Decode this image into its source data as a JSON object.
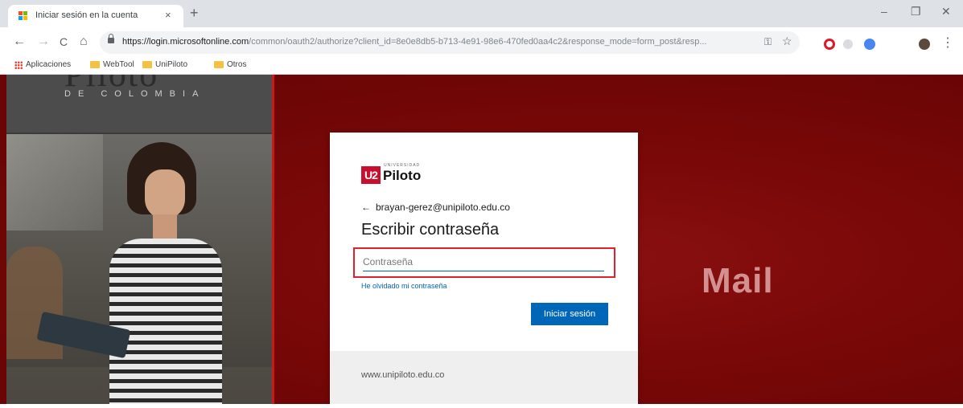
{
  "browser": {
    "tab": {
      "title": "Iniciar sesión en la cuenta",
      "close": "×"
    },
    "new_tab": "+",
    "window_controls": {
      "minimize": "–",
      "restore": "❐",
      "close": "✕"
    },
    "nav": {
      "back": "←",
      "forward": "→",
      "reload": "C",
      "home": "⌂"
    },
    "address": {
      "host": "https://login.microsoftonline.com",
      "path": "/common/oauth2/authorize?client_id=8e0e8db5-b713-4e91-98e6-470fed0aa4c2&response_mode=form_post&resp..."
    },
    "omni_icons": {
      "key": "⚿",
      "star": "☆"
    },
    "menu": "⋮",
    "bookmarks": [
      {
        "label": "Aplicaciones",
        "icon": "apps-grid"
      },
      {
        "label": "WebTool",
        "icon": "folder"
      },
      {
        "label": "UniPiloto",
        "icon": "folder"
      },
      {
        "label": "Otros",
        "icon": "folder"
      }
    ]
  },
  "left_panel": {
    "logo_top": "Piloto",
    "logo_sub": "DE COLOMBIA"
  },
  "login": {
    "brand_mark": "U2",
    "brand_name": "Piloto",
    "brand_top": "UNIVERSIDAD",
    "back_arrow": "←",
    "email": "brayan-gerez@unipiloto.edu.co",
    "heading": "Escribir contraseña",
    "password_placeholder": "Contraseña",
    "password_value": "",
    "forgot": "He olvidado mi contraseña",
    "signin": "Iniciar sesión",
    "footer": "www.unipiloto.edu.co"
  },
  "banner": {
    "text": "Mail"
  },
  "colors": {
    "page_bg": "#7e0a0a",
    "accent_blue": "#0067b8",
    "focus_red": "#e0202a",
    "brand_red": "#c8102e"
  }
}
